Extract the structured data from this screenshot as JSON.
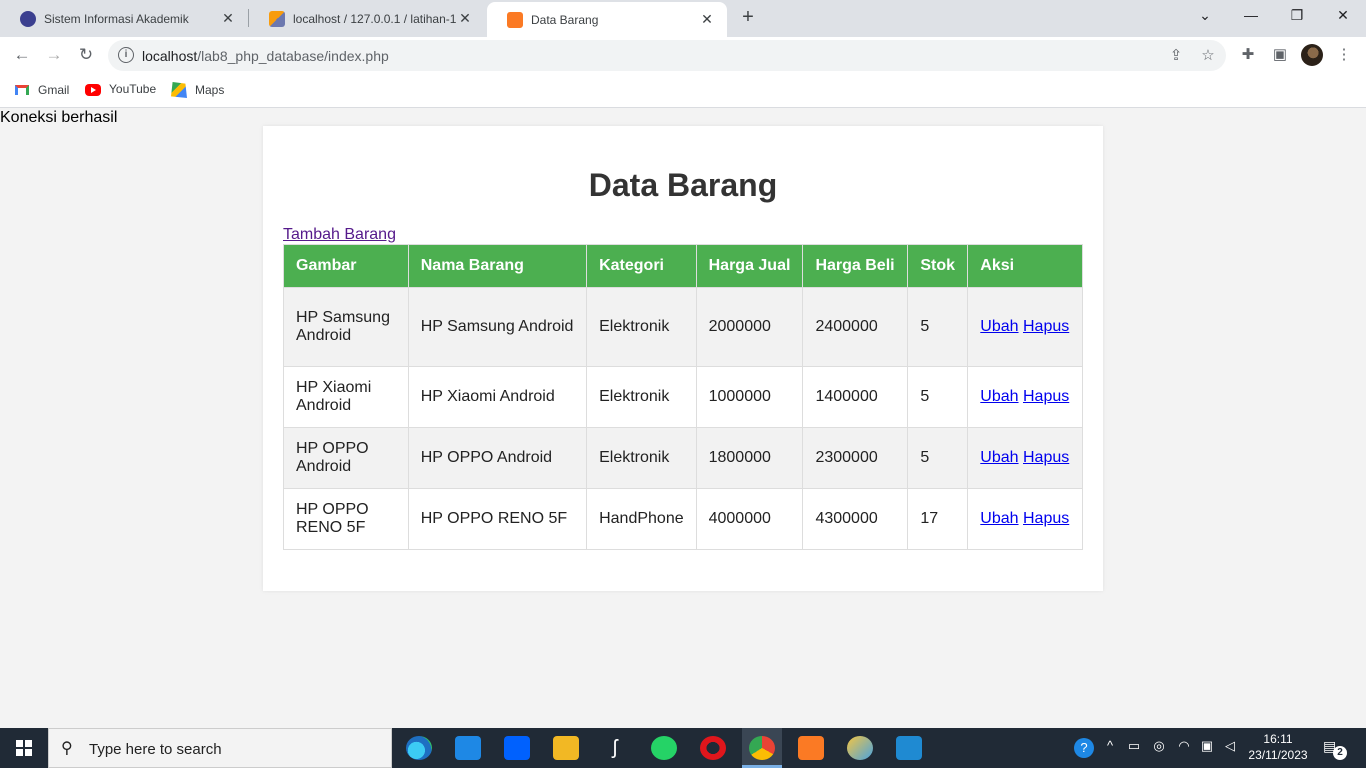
{
  "browser": {
    "tabs": [
      {
        "title": "Sistem Informasi Akademik",
        "active": false,
        "icon": "academic-logo-icon"
      },
      {
        "title": "localhost / 127.0.0.1 / latihan-1 /",
        "active": false,
        "icon": "phpmyadmin-icon"
      },
      {
        "title": "Data Barang",
        "active": true,
        "icon": "xampp-icon"
      }
    ],
    "url_host": "localhost",
    "url_path": "/lab8_php_database/index.php",
    "bookmarks": [
      {
        "label": "Gmail",
        "icon": "gmail-icon"
      },
      {
        "label": "YouTube",
        "icon": "youtube-icon"
      },
      {
        "label": "Maps",
        "icon": "maps-icon"
      }
    ]
  },
  "page": {
    "status_text": "Koneksi berhasil",
    "heading": "Data Barang",
    "add_link": "Tambah Barang",
    "table": {
      "headers": [
        "Gambar",
        "Nama Barang",
        "Kategori",
        "Harga Jual",
        "Harga Beli",
        "Stok",
        "Aksi"
      ],
      "rows": [
        {
          "gambar_alt": "HP Samsung Android",
          "nama": "HP Samsung Android",
          "kategori": "Elektronik",
          "harga_jual": "2000000",
          "harga_beli": "2400000",
          "stok": "5",
          "ubah": "Ubah",
          "hapus": "Hapus"
        },
        {
          "gambar_alt": "HP Xiaomi Android",
          "nama": "HP Xiaomi Android",
          "kategori": "Elektronik",
          "harga_jual": "1000000",
          "harga_beli": "1400000",
          "stok": "5",
          "ubah": "Ubah",
          "hapus": "Hapus"
        },
        {
          "gambar_alt": "HP OPPO Android",
          "nama": "HP OPPO Android",
          "kategori": "Elektronik",
          "harga_jual": "1800000",
          "harga_beli": "2300000",
          "stok": "5",
          "ubah": "Ubah",
          "hapus": "Hapus"
        },
        {
          "gambar_alt": "HP OPPO RENO 5F",
          "nama": "HP OPPO RENO 5F",
          "kategori": "HandPhone",
          "harga_jual": "4000000",
          "harga_beli": "4300000",
          "stok": "17",
          "ubah": "Ubah",
          "hapus": "Hapus"
        }
      ]
    }
  },
  "taskbar": {
    "search_placeholder": "Type here to search",
    "time": "16:11",
    "date": "23/11/2023",
    "notification_count": "2",
    "apps": [
      "edge-icon",
      "mail-icon",
      "dropbox-icon",
      "file-explorer-icon",
      "sublime-icon",
      "whatsapp-icon",
      "opera-icon",
      "chrome-icon",
      "xampp-icon",
      "paint-icon",
      "vscode-icon"
    ]
  },
  "colors": {
    "table_header": "#4caf50",
    "link": "#0000ee",
    "visited_link": "#551a8b"
  }
}
